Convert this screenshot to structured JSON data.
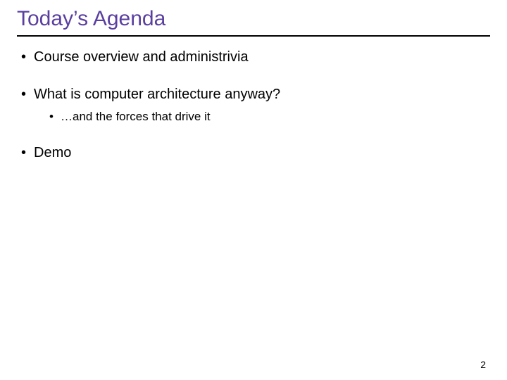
{
  "slide": {
    "title": "Today’s Agenda",
    "bullets": [
      {
        "text": "Course overview and administrivia",
        "children": []
      },
      {
        "text": "What is computer architecture anyway?",
        "children": [
          {
            "text": "…and the forces that drive it"
          }
        ]
      },
      {
        "text": "Demo",
        "children": []
      }
    ],
    "page_number": "2"
  }
}
